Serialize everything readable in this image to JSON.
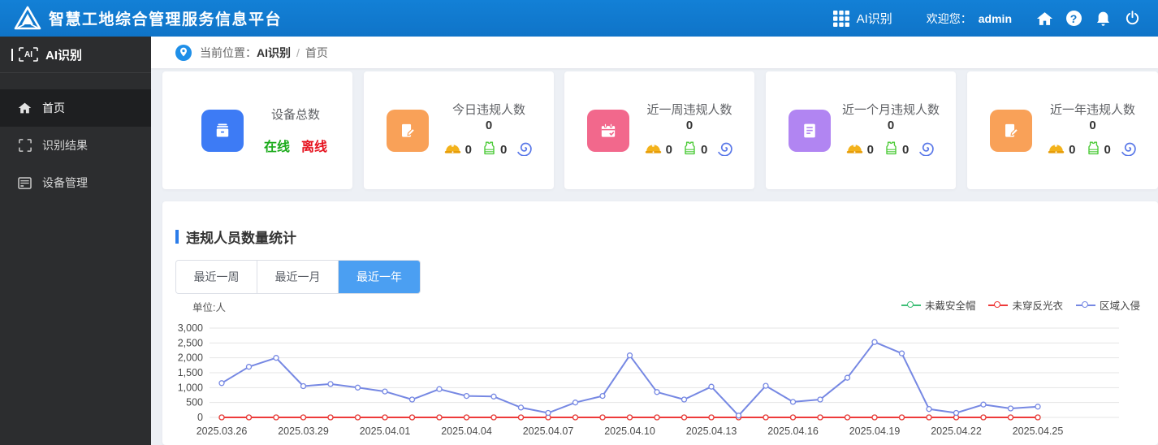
{
  "header": {
    "title": "智慧工地综合管理服务信息平台",
    "app_switch_label": "AI识别",
    "welcome_label": "欢迎您：",
    "username": "admin",
    "help_glyph": "?",
    "icons": [
      "grid-apps-icon",
      "home-icon",
      "help-icon",
      "bell-icon",
      "power-icon"
    ]
  },
  "sidebar": {
    "brand_ai_text": "AI",
    "title": "AI识别",
    "items": [
      {
        "label": "首页",
        "icon": "home-icon",
        "active": true
      },
      {
        "label": "识别结果",
        "icon": "scan-frame-icon",
        "active": false
      },
      {
        "label": "设备管理",
        "icon": "device-icon",
        "active": false
      }
    ]
  },
  "breadcrumb": {
    "prefix": "当前位置：",
    "root": "AI识别",
    "separator": "/",
    "current": "首页"
  },
  "cards": [
    {
      "title": "设备总数",
      "icon": "archive-box-icon",
      "icon_color": "#3d7bf5",
      "online_label": "在线",
      "offline_label": "离线",
      "online_color": "#1cab1c",
      "offline_color": "#e6131f"
    },
    {
      "title": "今日违规人数",
      "value": "0",
      "icon": "doc-edit-icon",
      "icon_color": "#f9a158",
      "helmet_count": "0",
      "vest_count": "0"
    },
    {
      "title": "近一周违规人数",
      "value": "0",
      "icon": "calendar-icon",
      "icon_color": "#f2688c",
      "helmet_count": "0",
      "vest_count": "0"
    },
    {
      "title": "近一个月违规人数",
      "value": "0",
      "icon": "doc-list-icon",
      "icon_color": "#b185f2",
      "helmet_count": "0",
      "vest_count": "0"
    },
    {
      "title": "近一年违规人数",
      "value": "0",
      "icon": "doc-edit-icon",
      "icon_color": "#f9a158",
      "helmet_count": "0",
      "vest_count": "0"
    }
  ],
  "stats_section": {
    "title": "违规人员数量统计",
    "tabs": [
      {
        "label": "最近一周",
        "active": false
      },
      {
        "label": "最近一月",
        "active": false
      },
      {
        "label": "最近一年",
        "active": true
      }
    ],
    "unit_label": "单位:人"
  },
  "chart_data": {
    "type": "line",
    "title": "违规人员数量统计",
    "unit": "单位:人",
    "legend_position": "top-right",
    "grid": true,
    "ylim": [
      0,
      3000
    ],
    "ytick_values": [
      0,
      500,
      1000,
      1500,
      2000,
      2500,
      3000
    ],
    "ytick_labels": [
      "0",
      "500",
      "1,000",
      "1,500",
      "2,000",
      "2,500",
      "3,000"
    ],
    "x_label_every": 3,
    "x": [
      "2025.03.26",
      "2025.03.27",
      "2025.03.28",
      "2025.03.29",
      "2025.03.30",
      "2025.03.31",
      "2025.04.01",
      "2025.04.02",
      "2025.04.03",
      "2025.04.04",
      "2025.04.05",
      "2025.04.06",
      "2025.04.07",
      "2025.04.08",
      "2025.04.09",
      "2025.04.10",
      "2025.04.11",
      "2025.04.12",
      "2025.04.13",
      "2025.04.14",
      "2025.04.15",
      "2025.04.16",
      "2025.04.17",
      "2025.04.18",
      "2025.04.19",
      "2025.04.20",
      "2025.04.21",
      "2025.04.22",
      "2025.04.23",
      "2025.04.24",
      "2025.04.25"
    ],
    "series": [
      {
        "name": "未戴安全帽",
        "color": "#3fbf77",
        "values": [
          0,
          0,
          0,
          0,
          0,
          0,
          0,
          0,
          0,
          0,
          0,
          0,
          0,
          0,
          0,
          0,
          0,
          0,
          0,
          0,
          0,
          0,
          0,
          0,
          0,
          0,
          0,
          0,
          0,
          0,
          0
        ]
      },
      {
        "name": "未穿反光衣",
        "color": "#ee3a3a",
        "values": [
          0,
          0,
          0,
          0,
          0,
          0,
          0,
          0,
          0,
          0,
          0,
          0,
          0,
          0,
          0,
          0,
          0,
          0,
          0,
          0,
          0,
          0,
          0,
          0,
          0,
          0,
          0,
          0,
          0,
          0,
          0
        ]
      },
      {
        "name": "区域入侵",
        "color": "#7688e3",
        "values": [
          1150,
          1700,
          2000,
          1050,
          1120,
          1000,
          870,
          600,
          950,
          720,
          700,
          330,
          150,
          500,
          720,
          2080,
          850,
          600,
          1030,
          60,
          1060,
          520,
          600,
          1330,
          2530,
          2150,
          280,
          150,
          430,
          300,
          360
        ]
      }
    ]
  }
}
